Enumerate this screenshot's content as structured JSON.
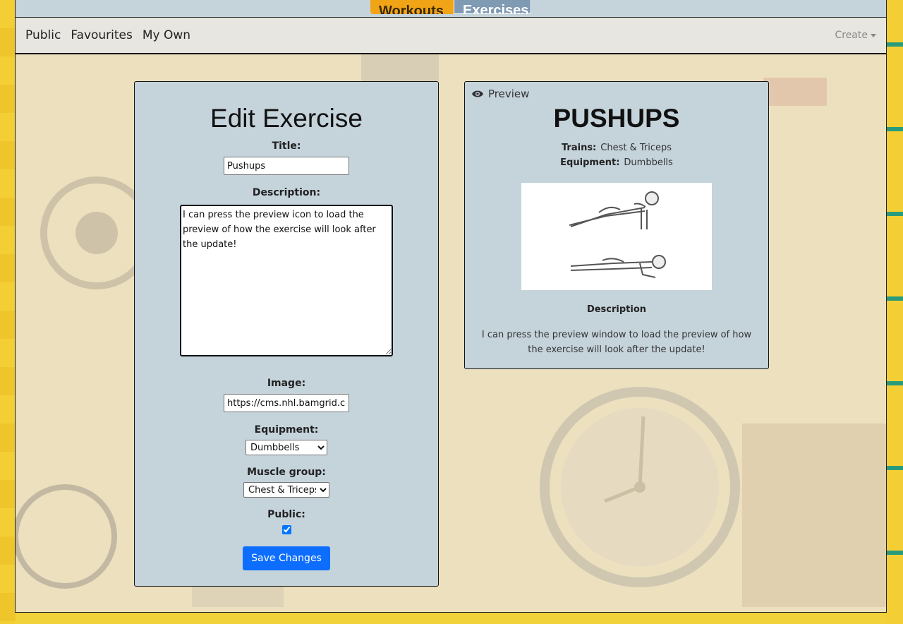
{
  "top_tabs": {
    "workouts": "Workouts",
    "exercises": "Exercises"
  },
  "subnav": {
    "items": [
      "Public",
      "Favourites",
      "My Own"
    ],
    "create_label": "Create"
  },
  "edit": {
    "heading": "Edit Exercise",
    "title_label": "Title:",
    "title_value": "Pushups",
    "description_label": "Description:",
    "description_value": "I can press the preview icon to load the preview of how the exercise will look after the update!",
    "image_label": "Image:",
    "image_value": "https://cms.nhl.bamgrid.co",
    "equipment_label": "Equipment:",
    "equipment_value": "Dumbbells",
    "muscle_label": "Muscle group:",
    "muscle_value": "Chest & Triceps",
    "public_label": "Public:",
    "public_checked": true,
    "save_label": "Save Changes"
  },
  "preview": {
    "label": "Preview",
    "title": "PUSHUPS",
    "trains_label": "Trains:",
    "trains_value": "Chest & Triceps",
    "equipment_label": "Equipment:",
    "equipment_value": "Dumbbells",
    "image_icon": "pushup-illustration",
    "description_label": "Description",
    "description_value": "I can press the preview window to load the preview of how the exercise will look after the update!"
  },
  "colors": {
    "panel": "#c5d3db",
    "accent_orange": "#f2a417",
    "tab_blue": "#7f9ab3",
    "button_blue": "#0d6efd",
    "page_yellow": "#f1d23a"
  }
}
